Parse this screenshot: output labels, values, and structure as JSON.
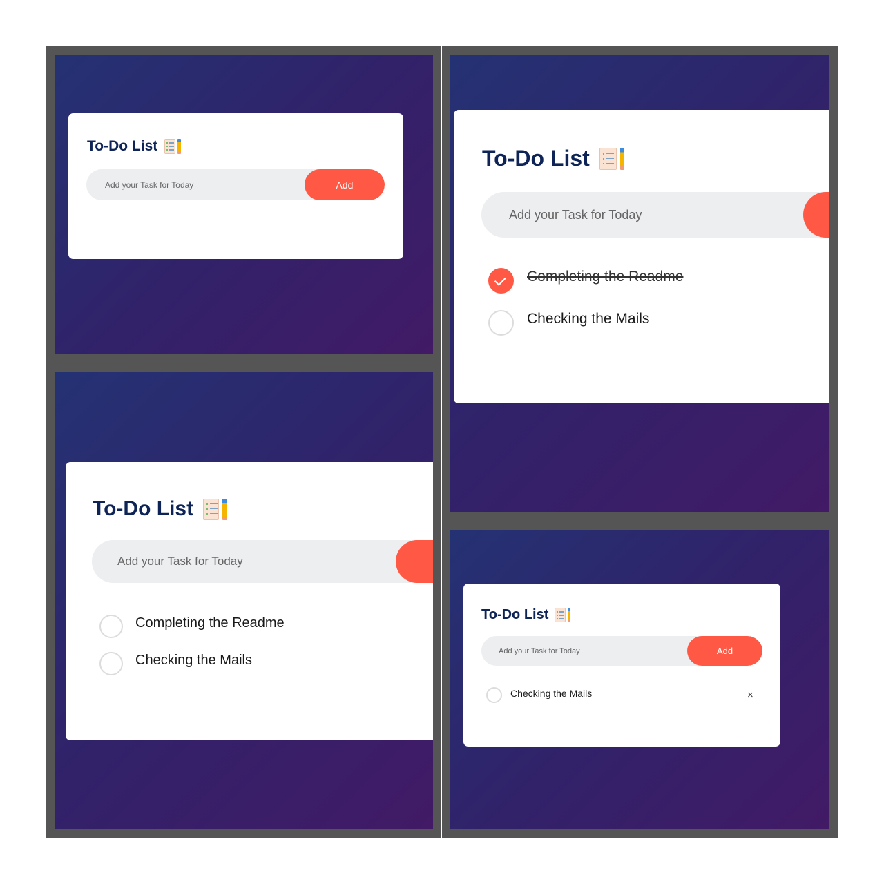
{
  "app_title": "To-Do List",
  "input_placeholder": "Add your Task for Today",
  "add_button_label": "Add",
  "tasks": {
    "readme": "Completing the Readme",
    "mails": "Checking the Mails"
  },
  "delete_label": "×",
  "colors": {
    "accent": "#ff5945",
    "title": "#0e2457",
    "background_start": "#243273",
    "background_end": "#421a66",
    "frame": "#555555"
  },
  "icons": [
    "checklist-pencil-emoji-icon",
    "checkmark-icon",
    "close-icon"
  ],
  "panels": [
    {
      "state": "empty list"
    },
    {
      "state": "first task completed",
      "tasks": [
        {
          "text_key": "readme",
          "completed": true
        },
        {
          "text_key": "mails",
          "completed": false
        }
      ]
    },
    {
      "state": "two tasks",
      "tasks": [
        {
          "text_key": "readme",
          "completed": false
        },
        {
          "text_key": "mails",
          "completed": false
        }
      ]
    },
    {
      "state": "one task remaining",
      "tasks": [
        {
          "text_key": "mails",
          "completed": false
        }
      ]
    }
  ]
}
